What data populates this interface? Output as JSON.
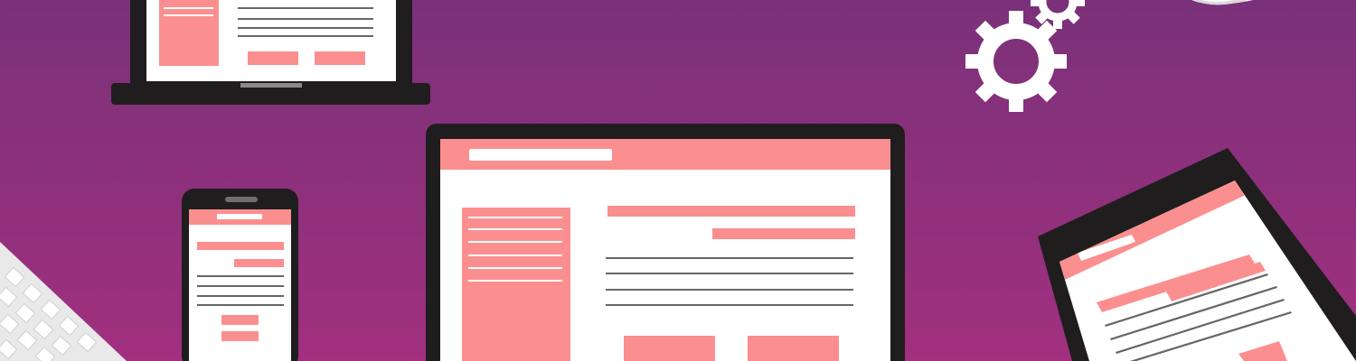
{
  "scene": {
    "subject": "responsive-web-design-illustration",
    "devices": [
      "laptop",
      "desktop-monitor",
      "smartphone",
      "tablet",
      "keyboard"
    ],
    "decorations": [
      "gear-icon-large",
      "gear-icon-small",
      "cloud-icon"
    ]
  },
  "colors": {
    "background_top": "#7a3179",
    "background_bottom": "#a1307f",
    "device_body": "#1f1d1e",
    "device_bezel": "#2b2a2b",
    "screen_bg": "#ffffff",
    "accent_block": "#fb8f8f",
    "text_line": "#666666",
    "gear": "#ffffff",
    "keyboard": "#e9e9e9",
    "keyboard_key": "#ffffff"
  }
}
